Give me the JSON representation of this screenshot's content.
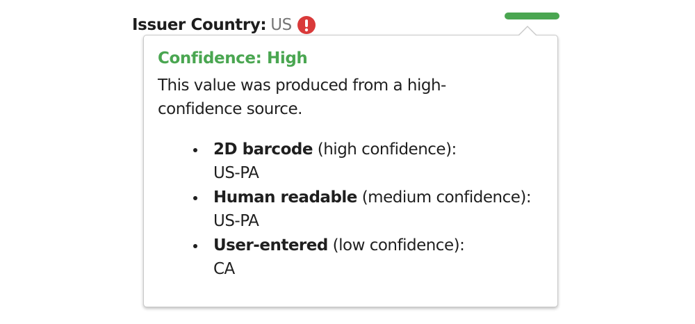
{
  "field": {
    "label": "Issuer Country:",
    "value": "US",
    "warning_icon": "exclamation-circle-icon"
  },
  "confidence_indicator": {
    "level": "high",
    "color": "#4aa651"
  },
  "tooltip": {
    "title": "Confidence: High",
    "title_color": "#4aa651",
    "description": "This value was produced from a high-confidence source.",
    "sources": [
      {
        "name": "2D barcode",
        "confidence": "(high confidence):",
        "value": "US-PA"
      },
      {
        "name": "Human readable",
        "confidence": "(medium confidence):",
        "value": "US-PA"
      },
      {
        "name": "User-entered",
        "confidence": "(low confidence):",
        "value": "CA"
      }
    ]
  },
  "colors": {
    "warning": "#d93a3a",
    "text": "#1f1f1f",
    "muted": "#767676"
  }
}
